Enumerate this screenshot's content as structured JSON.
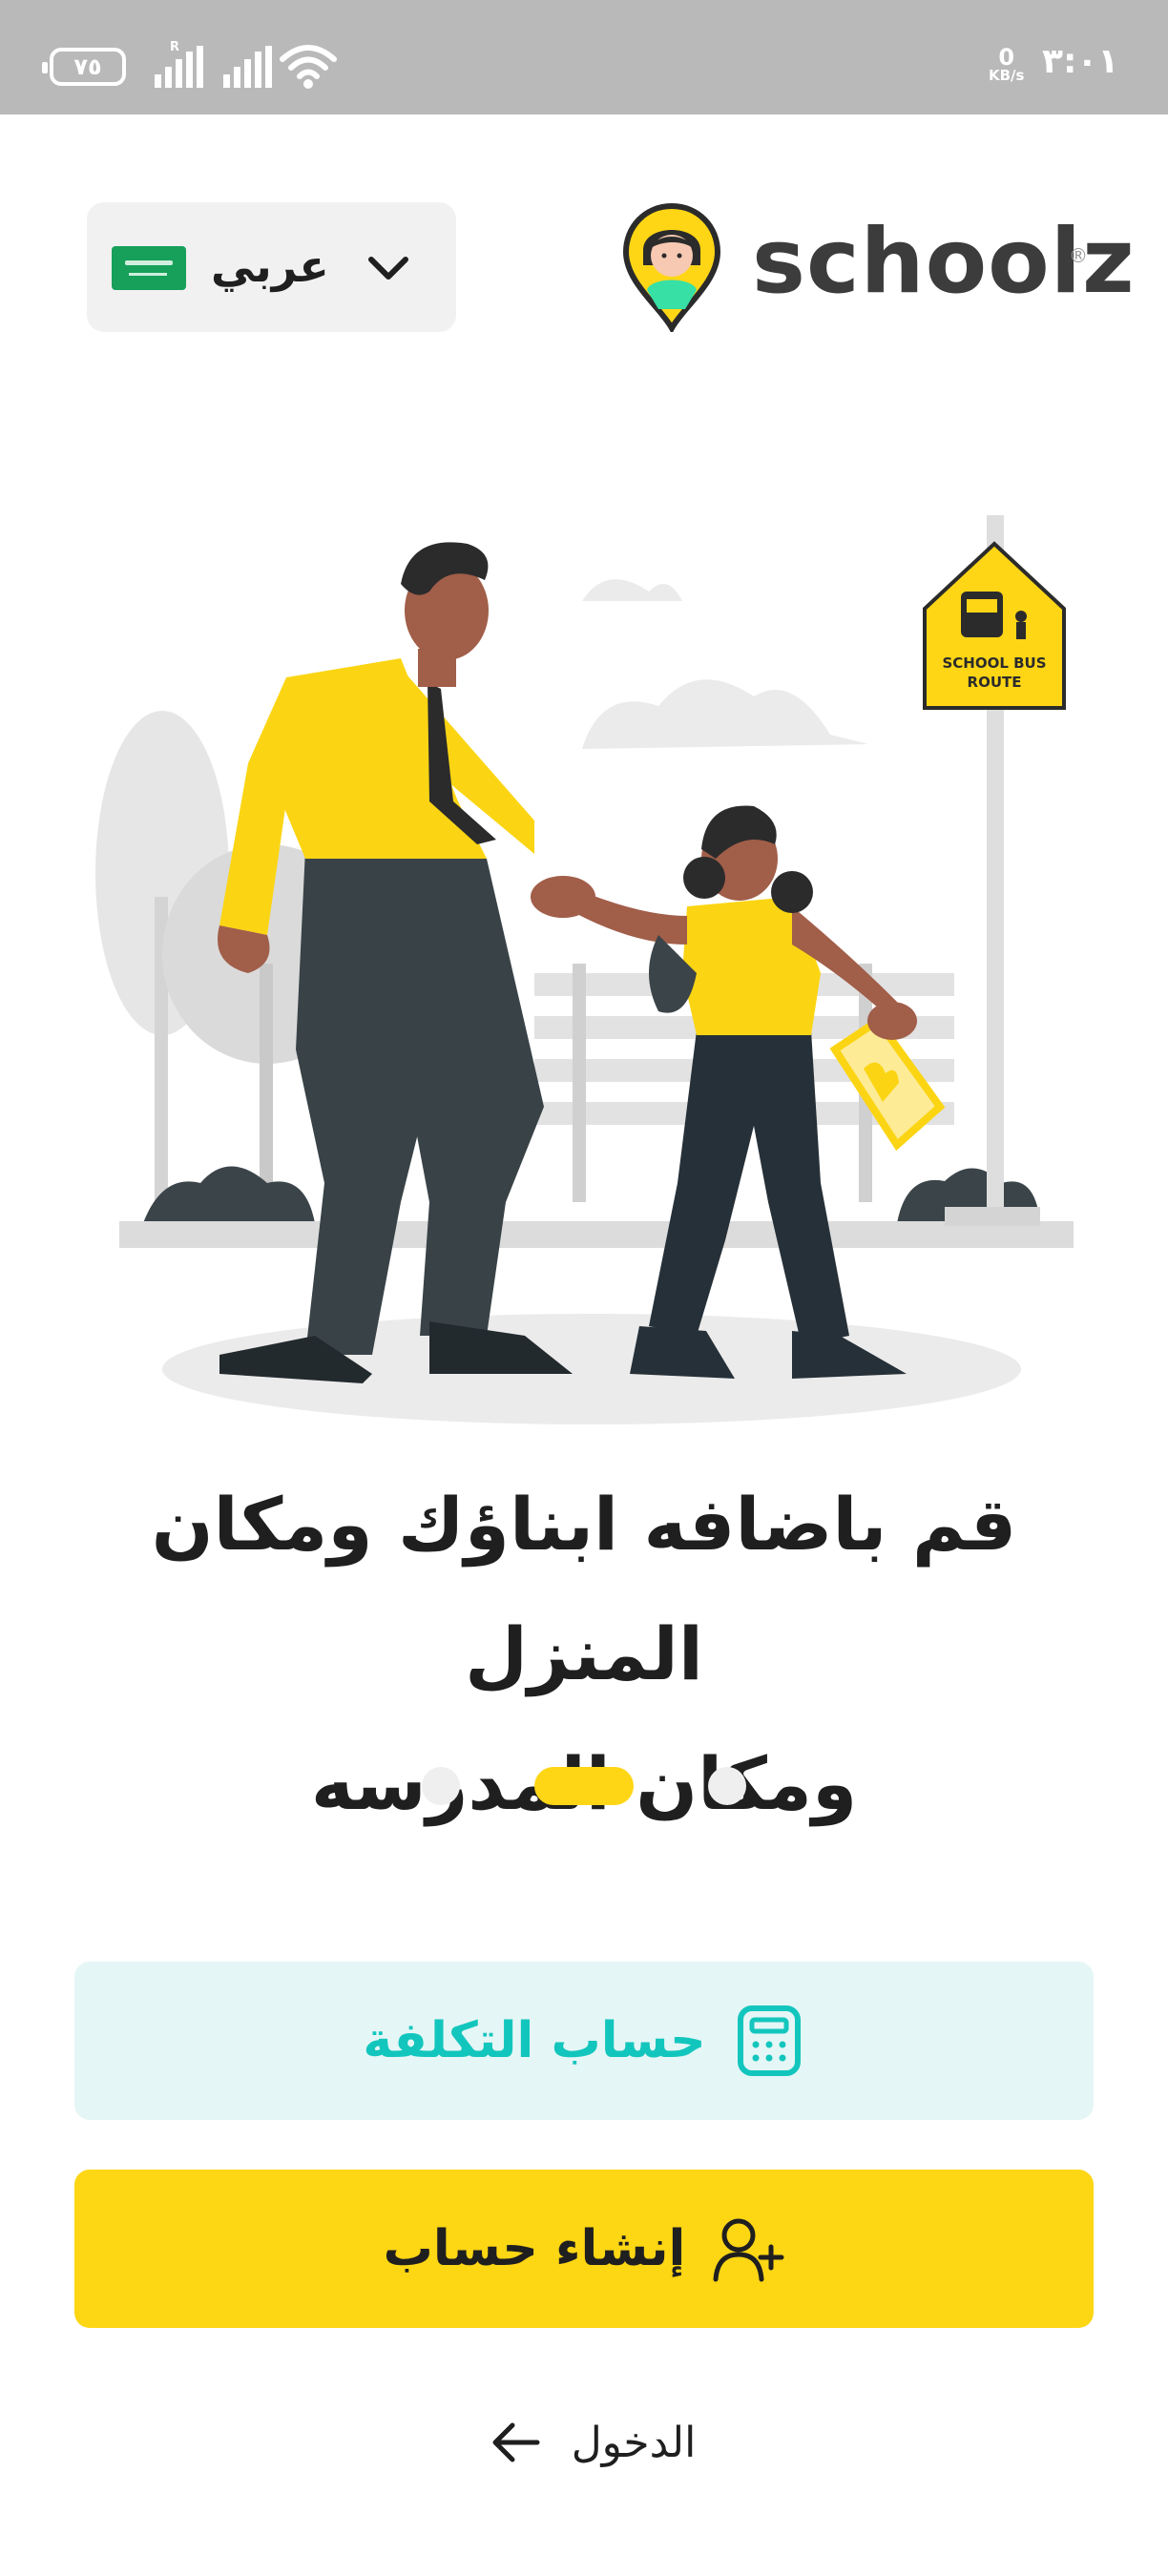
{
  "status_bar": {
    "battery": "٧٥",
    "signal_label": "R",
    "net_speed_value": "0",
    "net_speed_unit": "KB/s",
    "time": "٣:٠١"
  },
  "header": {
    "language_label": "عربي",
    "flag_icon": "saudi-flag-icon",
    "logo_text": "schoolz",
    "logo_mark": "®"
  },
  "illustration": {
    "sign_line1": "SCHOOL BUS",
    "sign_line2": "ROUTE"
  },
  "onboarding": {
    "headline_line1": "قم باضافه ابناؤك ومكان المنزل",
    "headline_line2": "ومكان المدرسه",
    "pager": {
      "total": 3,
      "active_index": 1
    }
  },
  "actions": {
    "cost_label": "حساب التكلفة",
    "create_label": "إنشاء حساب",
    "login_label": "الدخول"
  },
  "colors": {
    "accent_yellow": "#fdd614",
    "teal": "#13c6bd",
    "teal_bg": "#e5f6f6"
  }
}
